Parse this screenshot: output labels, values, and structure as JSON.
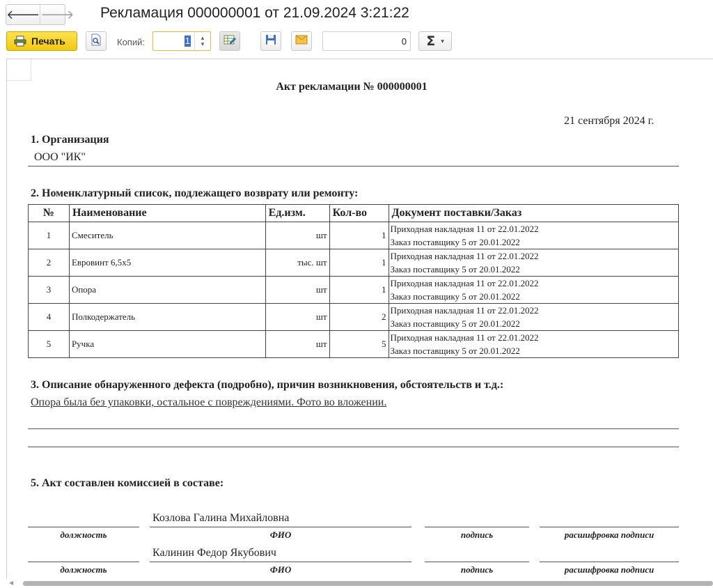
{
  "window": {
    "title": "Рекламация 000000001 от 21.09.2024 3:21:22",
    "back_icon": "arrow-left-icon",
    "forward_icon": "arrow-right-icon"
  },
  "toolbar": {
    "print_label": "Печать",
    "copies_label": "Копий:",
    "copies_value": "1",
    "sum_value": "0",
    "sigma": "Σ",
    "icons": [
      "printer-icon",
      "preview-icon",
      "edit-table-icon",
      "save-icon",
      "email-icon",
      "sum-icon"
    ]
  },
  "document": {
    "title": "Акт рекламации № 000000001",
    "date": "21 сентября 2024 г.",
    "section1": {
      "heading": "1. Организация",
      "value": "ООО \"ИК\""
    },
    "section2": {
      "heading": "2. Номенклатурный список, подлежащего возврату или ремонту:",
      "columns": [
        "№",
        "Наименование",
        "Ед.изм.",
        "Кол-во",
        "Документ поставки/Заказ"
      ],
      "rows": [
        {
          "n": "1",
          "name": "Смеситель",
          "unit": "шт",
          "qty": "1",
          "doc1": "Приходная накладная 11 от 22.01.2022",
          "doc2": "Заказ поставщику 5 от 20.01.2022"
        },
        {
          "n": "2",
          "name": "Евровинт 6,5х5",
          "unit": "тыс. шт",
          "qty": "1",
          "doc1": "Приходная накладная 11 от 22.01.2022",
          "doc2": "Заказ поставщику 5 от 20.01.2022"
        },
        {
          "n": "3",
          "name": "Опора",
          "unit": "шт",
          "qty": "1",
          "doc1": "Приходная накладная 11 от 22.01.2022",
          "doc2": "Заказ поставщику 5 от 20.01.2022"
        },
        {
          "n": "4",
          "name": "Полкодержатель",
          "unit": "шт",
          "qty": "2",
          "doc1": "Приходная накладная 11 от 22.01.2022",
          "doc2": "Заказ поставщику 5 от 20.01.2022"
        },
        {
          "n": "5",
          "name": "Ручка",
          "unit": "шт",
          "qty": "5",
          "doc1": "Приходная накладная 11 от 22.01.2022",
          "doc2": "Заказ поставщику 5 от 20.01.2022"
        }
      ]
    },
    "section3": {
      "heading": "3. Описание обнаруженного дефекта (подробно), причин возникновения, обстоятельств и т.д.:",
      "value": "Опора была без упаковки, остальное с повреждениями. Фото во вложении."
    },
    "section5": {
      "heading": "5. Акт составлен комиссией в составе:",
      "labels": {
        "position": "должность",
        "fio": "ФИО",
        "signature": "подпись",
        "decoding": "расшифровка подписи"
      },
      "members": [
        "Козлова Галина Михайловна",
        "Калинин Федор Якубович"
      ]
    }
  }
}
